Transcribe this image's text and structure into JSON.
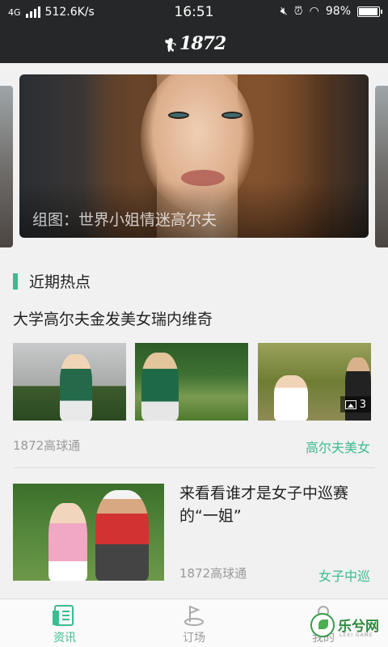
{
  "status_bar": {
    "network": "4G",
    "speed": "512.6K/s",
    "time": "16:51",
    "battery": "98%",
    "battery_level": 0.98
  },
  "app_bar": {
    "logo_text": "1872",
    "logo_icon": "golfer-icon"
  },
  "carousel": {
    "caption": "组图：世界小姐情迷高尔夫"
  },
  "section": {
    "title": "近期热点"
  },
  "articles": [
    {
      "title": "大学高尔夫金发美女瑞内维奇",
      "source": "1872高球通",
      "tag": "高尔夫美女",
      "photo_count": "3"
    },
    {
      "title": "来看看谁才是女子中巡赛的“一姐”",
      "source": "1872高球通",
      "tag": "女子中巡"
    }
  ],
  "bottom_nav": [
    {
      "label": "资讯",
      "icon": "news-icon",
      "active": true
    },
    {
      "label": "订场",
      "icon": "golf-course-icon",
      "active": false
    },
    {
      "label": "我的",
      "icon": "profile-icon",
      "active": false
    }
  ],
  "watermark": {
    "text": "乐兮网",
    "sub": "LEXI GAME"
  },
  "colors": {
    "accent": "#3bbc92",
    "header": "#262728"
  }
}
